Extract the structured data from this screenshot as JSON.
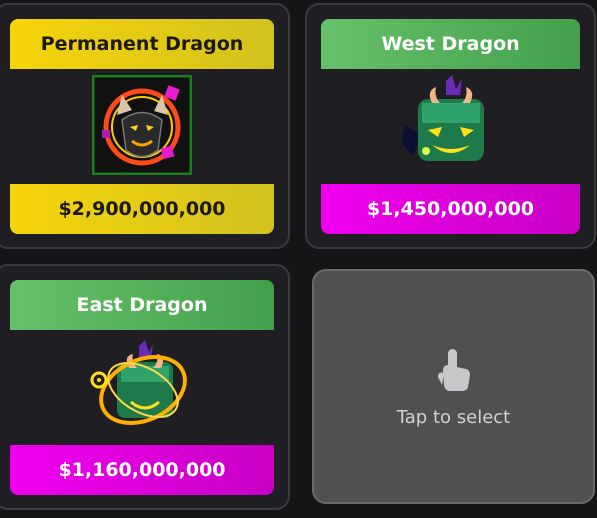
{
  "cards": [
    {
      "title": "Permanent Dragon",
      "price": "$2,900,000,000",
      "icon": "permanent-dragon-icon"
    },
    {
      "title": "West Dragon",
      "price": "$1,450,000,000",
      "icon": "west-dragon-fruit-icon"
    },
    {
      "title": "East Dragon",
      "price": "$1,160,000,000",
      "icon": "east-dragon-fruit-icon"
    }
  ],
  "empty_slot": {
    "label": "Tap to select",
    "icon": "tap-finger-icon"
  },
  "colors": {
    "gold": "#f6d40a",
    "green": "#4caf50",
    "magenta": "#e600e6",
    "card_bg": "#1f1f23",
    "empty_bg": "#505051"
  }
}
